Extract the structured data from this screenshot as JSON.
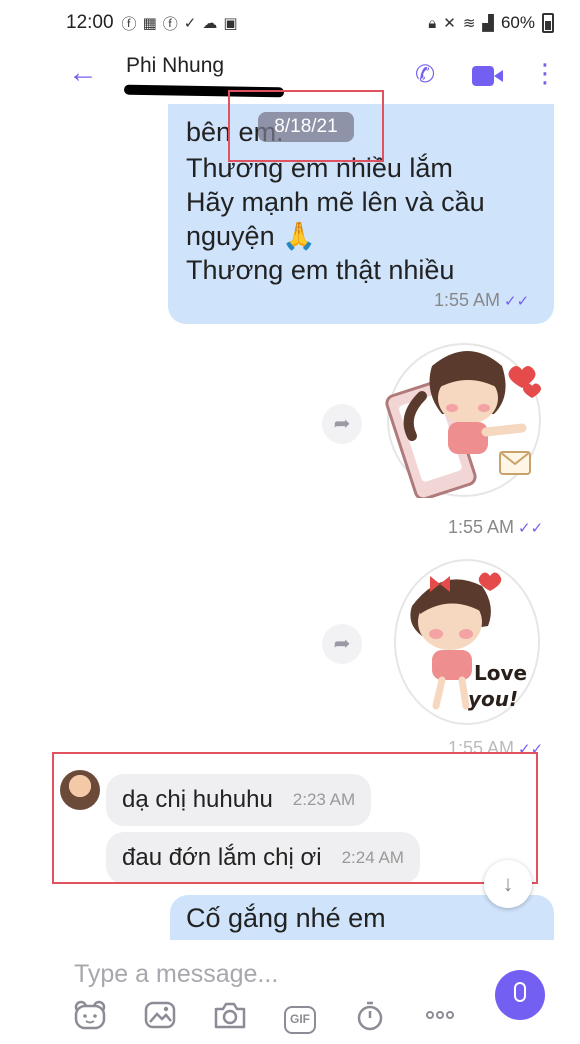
{
  "status_bar": {
    "time": "12:00",
    "battery": "60%",
    "left_icons": [
      "facebook-icon",
      "calendar-icon",
      "facebook-icon",
      "download-done-icon",
      "cloud-icon",
      "screenshot-icon"
    ],
    "right_icons": [
      "lock-icon",
      "mute-icon",
      "wifi-icon",
      "signal-icon",
      "battery-icon"
    ]
  },
  "header": {
    "contact_name": "Phi Nhung",
    "icons": [
      "back-arrow-icon",
      "phone-icon",
      "video-icon",
      "more-vertical-icon"
    ]
  },
  "date_pill": "8/18/21",
  "messages": {
    "top_bubble_lines": [
      "bên em.",
      "Thương em nhiều lắm",
      "Hãy mạnh mẽ lên và cầu",
      "nguyện 🙏",
      "Thương em thật nhiều"
    ],
    "top_bubble_time": "1:55 AM",
    "sticker1_time": "1:55 AM",
    "sticker2_time": "1:55 AM",
    "sticker2_text": [
      "Love",
      "you!"
    ],
    "incoming": [
      {
        "text": "dạ chị huhuhu",
        "time": "2:23 AM"
      },
      {
        "text": "đau đớn lắm chị ơi",
        "time": "2:24 AM"
      }
    ],
    "last_bubble_text": "Cố gắng nhé em"
  },
  "composer": {
    "placeholder": "Type a message...",
    "gif_label": "GIF",
    "tools": [
      "sticker-icon",
      "gallery-icon",
      "camera-icon",
      "gif-icon",
      "timer-icon",
      "more-horizontal-icon"
    ]
  },
  "colors": {
    "accent": "#7360f2",
    "outgoing_bubble": "#cfe3fb",
    "incoming_bubble": "#efeff1",
    "highlight_box": "#e05260"
  }
}
